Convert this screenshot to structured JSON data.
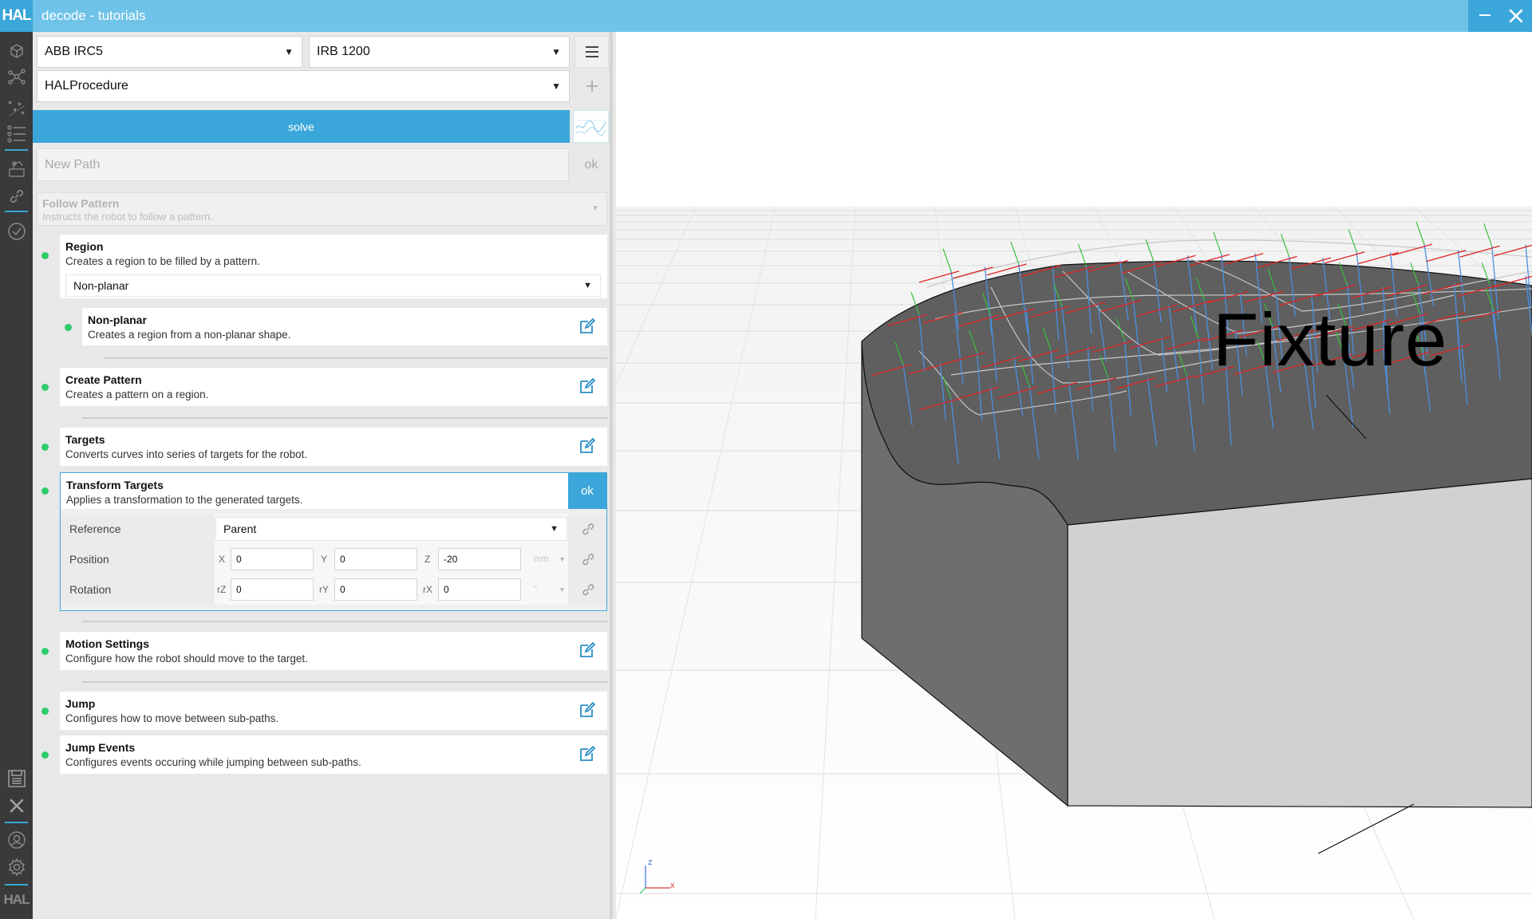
{
  "app": {
    "logo": "HAL",
    "window_title": "decode - tutorials"
  },
  "sidebar": {
    "icons": [
      "cube-icon",
      "network-icon",
      "scatter-icon",
      "list-icon",
      "robot-icon",
      "link-icon",
      "check-icon"
    ],
    "bottom_icons": [
      "save-icon",
      "close-icon",
      "user-icon",
      "gear-icon"
    ],
    "footer_logo": "HAL",
    "accent": "#3ba6d9"
  },
  "toolbar": {
    "controller": "ABB IRC5",
    "robot": "IRB 1200",
    "procedure": "HALProcedure",
    "solve_label": "solve",
    "new_path_placeholder": "New Path",
    "new_path_ok": "ok"
  },
  "pattern": {
    "title": "Follow Pattern",
    "description": "Instructs the robot to follow a pattern."
  },
  "steps": {
    "region": {
      "title": "Region",
      "description": "Creates a region to be filled by a pattern.",
      "selected": "Non-planar",
      "child": {
        "title": "Non-planar",
        "description": "Creates a region from a non-planar shape."
      }
    },
    "create_pattern": {
      "title": "Create Pattern",
      "description": "Creates a pattern on a region."
    },
    "targets": {
      "title": "Targets",
      "description": "Converts curves into series of targets for the robot."
    },
    "transform": {
      "title": "Transform Targets",
      "description": "Applies a transformation to the generated targets.",
      "ok_label": "ok",
      "reference_label": "Reference",
      "reference_value": "Parent",
      "position_label": "Position",
      "position": {
        "x_label": "X",
        "x": "0",
        "y_label": "Y",
        "y": "0",
        "z_label": "Z",
        "z": "-20",
        "unit": "mm"
      },
      "rotation_label": "Rotation",
      "rotation": {
        "rz_label": "rZ",
        "rz": "0",
        "ry_label": "rY",
        "ry": "0",
        "rx_label": "rX",
        "rx": "0",
        "unit": "°"
      }
    },
    "motion": {
      "title": "Motion Settings",
      "description": "Configure how the robot should move to the target."
    },
    "jump": {
      "title": "Jump",
      "description": "Configures how to move between sub-paths."
    },
    "jump_events": {
      "title": "Jump Events",
      "description": "Configures events occuring while jumping between sub-paths."
    }
  },
  "viewport": {
    "object_label": "Fixture",
    "axis_z": "z",
    "axis_x": "x",
    "status_color": "#2ecc6a"
  }
}
